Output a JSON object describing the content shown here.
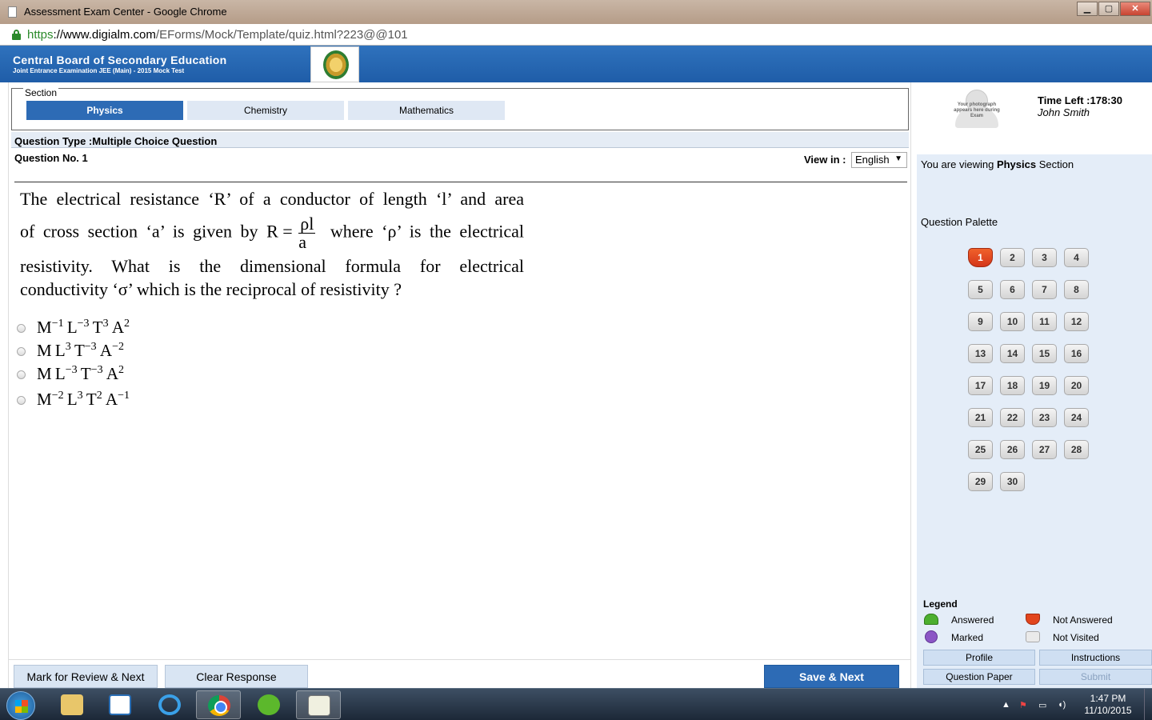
{
  "window": {
    "title": "Assessment Exam Center - Google Chrome"
  },
  "browser": {
    "url_scheme": "https",
    "url_host": "://www.digialm.com",
    "url_path": "/EForms/Mock/Template/quiz.html?223@@101"
  },
  "header": {
    "org": "Central Board of Secondary Education",
    "exam": "Joint Entrance Examination JEE (Main) - 2015 Mock Test"
  },
  "section": {
    "legend": "Section",
    "tabs": [
      {
        "label": "Physics",
        "active": true
      },
      {
        "label": "Chemistry",
        "active": false
      },
      {
        "label": "Mathematics",
        "active": false
      }
    ]
  },
  "question": {
    "type_label": "Question Type :Multiple Choice Question",
    "number_label": "Question No. 1",
    "view_in_label": "View in :",
    "language": "English",
    "lines": [
      "The electrical resistance ‘R’ of a conductor of length ‘l’ and area",
      "of cross section ‘a’ is given by",
      "where ‘ρ’ is the electrical",
      "resistivity.  What is the dimensional formula for electrical",
      "conductivity ‘σ’ which is the reciprocal of resistivity ?"
    ],
    "formula": {
      "lhs": "R =",
      "numerator": "ρl",
      "denominator": "a"
    },
    "options": [
      {
        "parts": [
          [
            "M",
            "−1"
          ],
          [
            "L",
            "−3"
          ],
          [
            "T",
            "3"
          ],
          [
            "A",
            "2"
          ]
        ]
      },
      {
        "parts": [
          [
            "M",
            ""
          ],
          [
            "L",
            "3"
          ],
          [
            "T",
            "−3"
          ],
          [
            "A",
            "−2"
          ]
        ]
      },
      {
        "parts": [
          [
            "M",
            ""
          ],
          [
            "L",
            "−3"
          ],
          [
            "T",
            "−3"
          ],
          [
            "A",
            "2"
          ]
        ]
      },
      {
        "parts": [
          [
            "M",
            "−2"
          ],
          [
            "L",
            "3"
          ],
          [
            "T",
            "2"
          ],
          [
            "A",
            "−1"
          ]
        ]
      }
    ]
  },
  "actions": {
    "mark_review": "Mark for Review & Next",
    "clear": "Clear Response",
    "save_next": "Save & Next"
  },
  "candidate": {
    "photo_caption": "Your photograph appears here during Exam",
    "time_left": "Time Left :178:30",
    "name": "John Smith"
  },
  "palette": {
    "viewing_prefix": "You are viewing",
    "viewing_section": "Physics",
    "viewing_suffix": "Section",
    "title": "Question Palette",
    "questions": [
      {
        "n": "1",
        "status": "not-answered"
      },
      {
        "n": "2",
        "status": "not-visited"
      },
      {
        "n": "3",
        "status": "not-visited"
      },
      {
        "n": "4",
        "status": "not-visited"
      },
      {
        "n": "5",
        "status": "not-visited"
      },
      {
        "n": "6",
        "status": "not-visited"
      },
      {
        "n": "7",
        "status": "not-visited"
      },
      {
        "n": "8",
        "status": "not-visited"
      },
      {
        "n": "9",
        "status": "not-visited"
      },
      {
        "n": "10",
        "status": "not-visited"
      },
      {
        "n": "11",
        "status": "not-visited"
      },
      {
        "n": "12",
        "status": "not-visited"
      },
      {
        "n": "13",
        "status": "not-visited"
      },
      {
        "n": "14",
        "status": "not-visited"
      },
      {
        "n": "15",
        "status": "not-visited"
      },
      {
        "n": "16",
        "status": "not-visited"
      },
      {
        "n": "17",
        "status": "not-visited"
      },
      {
        "n": "18",
        "status": "not-visited"
      },
      {
        "n": "19",
        "status": "not-visited"
      },
      {
        "n": "20",
        "status": "not-visited"
      },
      {
        "n": "21",
        "status": "not-visited"
      },
      {
        "n": "22",
        "status": "not-visited"
      },
      {
        "n": "23",
        "status": "not-visited"
      },
      {
        "n": "24",
        "status": "not-visited"
      },
      {
        "n": "25",
        "status": "not-visited"
      },
      {
        "n": "26",
        "status": "not-visited"
      },
      {
        "n": "27",
        "status": "not-visited"
      },
      {
        "n": "28",
        "status": "not-visited"
      },
      {
        "n": "29",
        "status": "not-visited"
      },
      {
        "n": "30",
        "status": "not-visited"
      }
    ]
  },
  "legend": {
    "title": "Legend",
    "answered": "Answered",
    "not_answered": "Not Answered",
    "marked": "Marked",
    "not_visited": "Not Visited"
  },
  "side_buttons": {
    "profile": "Profile",
    "instructions": "Instructions",
    "question_paper": "Question Paper",
    "submit": "Submit"
  },
  "colors": {
    "brand_blue": "#2d6bb5",
    "not_answered": "#e2451d",
    "answered": "#4caf2f",
    "marked": "#8b55c5"
  },
  "taskbar": {
    "time": "1:47 PM",
    "date": "11/10/2015"
  }
}
